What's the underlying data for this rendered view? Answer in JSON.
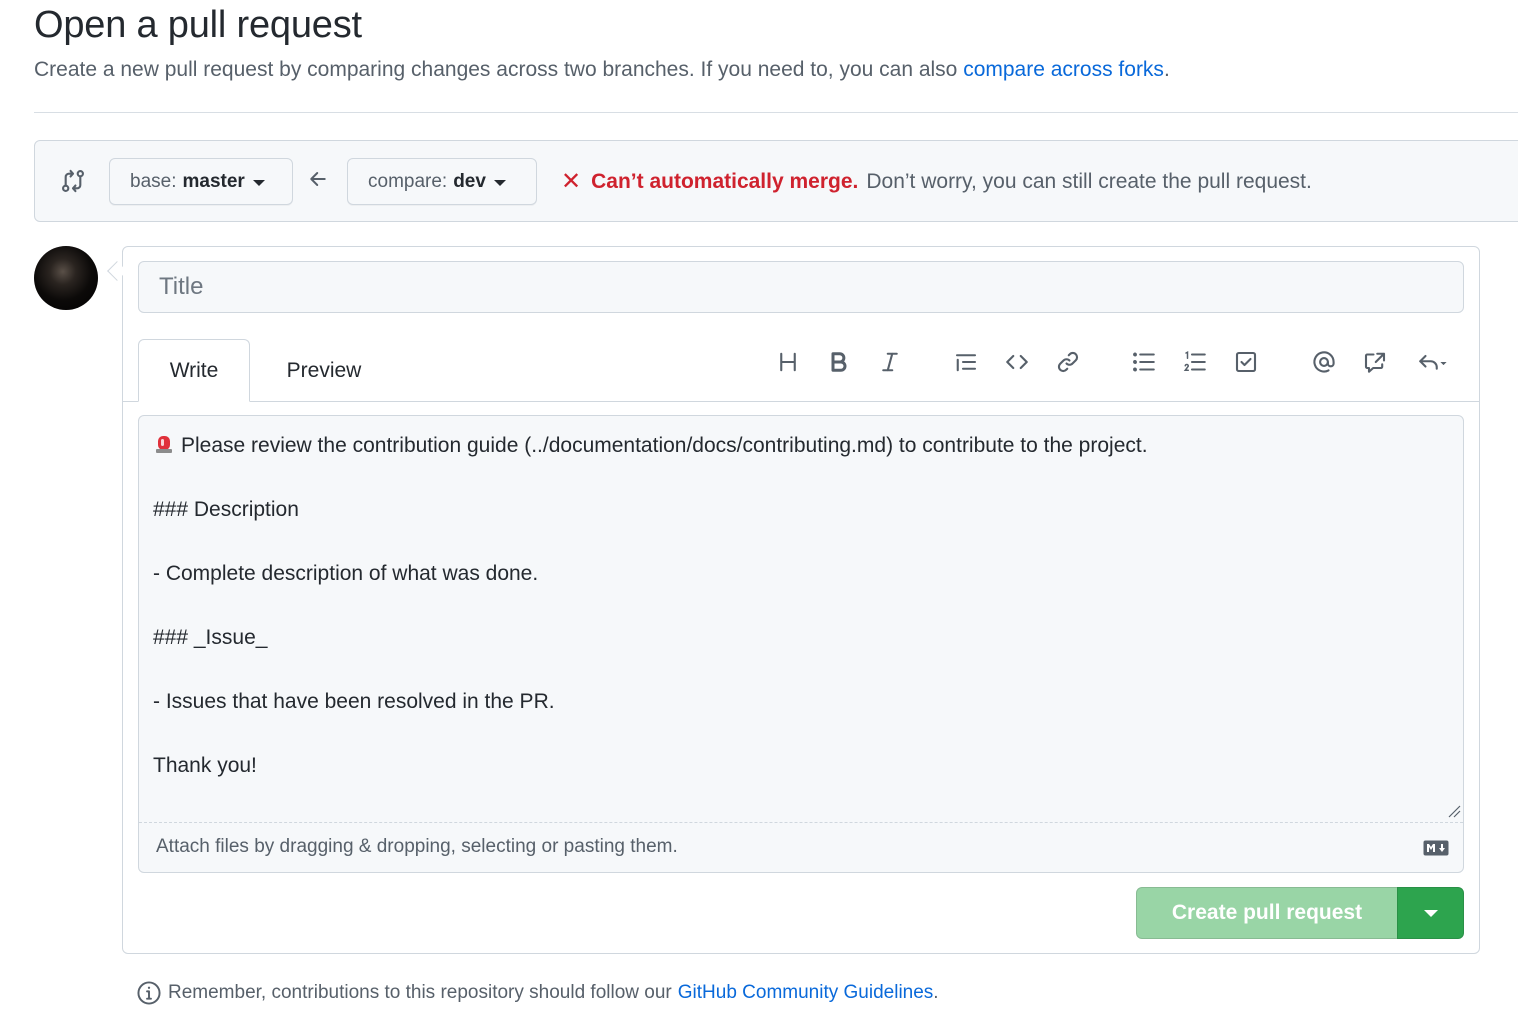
{
  "header": {
    "title": "Open a pull request",
    "subtitle_prefix": "Create a new pull request by comparing changes across two branches. If you need to, you can also ",
    "subtitle_link": "compare across forks",
    "subtitle_suffix": "."
  },
  "range": {
    "base_label": "base:",
    "base_value": "master",
    "compare_label": "compare:",
    "compare_value": "dev",
    "merge_error": "Can’t automatically merge.",
    "merge_note": "Don’t worry, you can still create the pull request."
  },
  "composer": {
    "title_placeholder": "Title",
    "tabs": [
      {
        "label": "Write"
      },
      {
        "label": "Preview"
      }
    ],
    "toolbar_icons": [
      "heading-icon",
      "bold-icon",
      "italic-icon",
      "quote-icon",
      "code-icon",
      "link-icon",
      "unordered-list-icon",
      "ordered-list-icon",
      "task-list-icon",
      "mention-icon",
      "reference-icon",
      "reply-icon"
    ],
    "body_lines": [
      "Please review the contribution guide (../documentation/docs/contributing.md) to contribute to the project.",
      "",
      "### Description",
      "",
      "- Complete description of what was done.",
      "",
      "### _Issue_",
      "",
      "- Issues that have been resolved in the PR.",
      "",
      "Thank you!"
    ],
    "attach_text": "Attach files by dragging & dropping, selecting or pasting them.",
    "create_label": "Create pull request"
  },
  "footer": {
    "note_prefix": "Remember, contributions to this repository should follow our",
    "note_link": "GitHub Community Guidelines",
    "note_suffix": "."
  },
  "colors": {
    "link": "#0969da",
    "error": "#cf222e",
    "create_disabled": "#94d3a2",
    "create_dropdown": "#2da44e"
  }
}
